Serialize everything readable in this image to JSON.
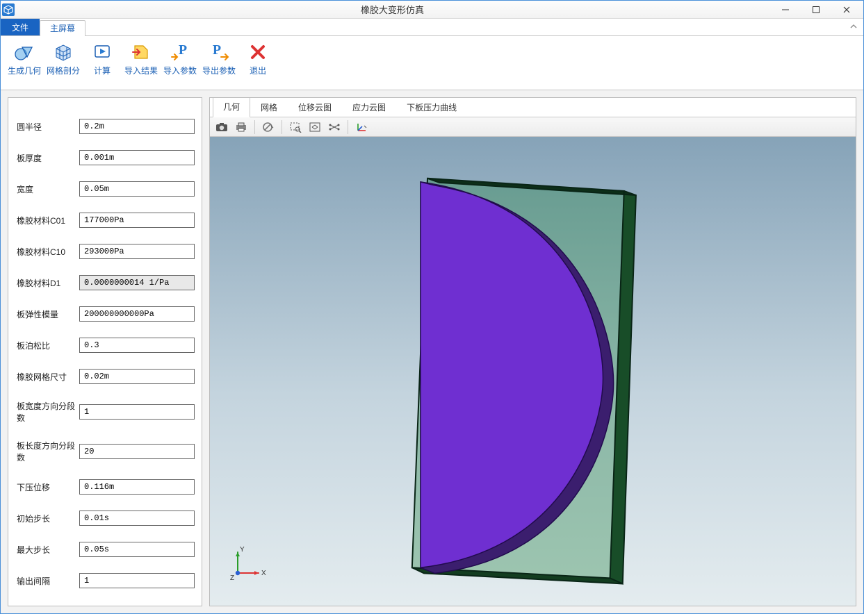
{
  "window": {
    "title": "橡胶大变形仿真"
  },
  "ribbon_tabs": {
    "file": "文件",
    "main": "主屏幕"
  },
  "ribbon": {
    "gen_geom": "生成几何",
    "mesh": "网格剖分",
    "compute": "计算",
    "import_result": "导入结果",
    "import_param": "导入参数",
    "export_param": "导出参数",
    "exit": "退出"
  },
  "params": {
    "radius": {
      "label": "圆半径",
      "value": "0.2m"
    },
    "thickness": {
      "label": "板厚度",
      "value": "0.001m"
    },
    "width": {
      "label": "宽度",
      "value": "0.05m"
    },
    "c01": {
      "label": "橡胶材料C01",
      "value": "177000Pa"
    },
    "c10": {
      "label": "橡胶材料C10",
      "value": "293000Pa"
    },
    "d1": {
      "label": "橡胶材料D1",
      "value": "0.0000000014 1/Pa",
      "disabled": true
    },
    "young": {
      "label": "板弹性模量",
      "value": "200000000000Pa"
    },
    "poisson": {
      "label": "板泊松比",
      "value": "0.3"
    },
    "rubber_mesh": {
      "label": "橡胶网格尺寸",
      "value": "0.02m"
    },
    "seg_width": {
      "label": "板宽度方向分段数",
      "value": "1"
    },
    "seg_length": {
      "label": "板长度方向分段数",
      "value": "20"
    },
    "press_disp": {
      "label": "下压位移",
      "value": "0.116m"
    },
    "init_step": {
      "label": "初始步长",
      "value": "0.01s"
    },
    "max_step": {
      "label": "最大步长",
      "value": "0.05s"
    },
    "out_interval": {
      "label": "输出间隔",
      "value": "1"
    }
  },
  "view_tabs": {
    "geom": "几何",
    "mesh": "网格",
    "disp_plot": "位移云图",
    "stress": "应力云图",
    "curve": "下板压力曲线"
  },
  "triad": {
    "x": "X",
    "y": "Y",
    "z": "Z"
  },
  "toolbar_icons": {
    "camera": "camera-icon",
    "print": "print-icon",
    "nodeny": "forbid-icon",
    "zoom_sel": "zoom-select-icon",
    "fit": "fit-icon",
    "orbit": "orbit-icon",
    "axes": "axes-icon"
  }
}
